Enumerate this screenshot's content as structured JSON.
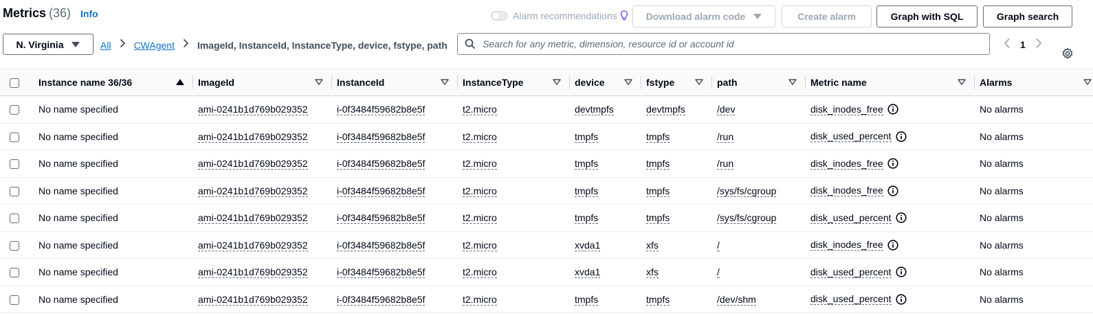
{
  "header": {
    "title": "Metrics",
    "count": "(36)",
    "info_label": "Info",
    "alarm_recommendations_label": "Alarm recommendations",
    "download_alarm_code_label": "Download alarm code",
    "create_alarm_label": "Create alarm",
    "graph_with_sql_label": "Graph with SQL",
    "graph_search_label": "Graph search"
  },
  "toolbar": {
    "region_label": "N. Virginia",
    "breadcrumb": {
      "all": "All",
      "namespace": "CWAgent",
      "current": "ImageId, InstanceId, InstanceType, device, fstype, path"
    },
    "search": {
      "placeholder": "Search for any metric, dimension, resource id or account id",
      "value": ""
    },
    "page_number": "1"
  },
  "table": {
    "columns": [
      "Instance name 36/36",
      "ImageId",
      "InstanceId",
      "InstanceType",
      "device",
      "fstype",
      "path",
      "Metric name",
      "Alarms"
    ],
    "rows": [
      {
        "instance_name": "No name specified",
        "image_id": "ami-0241b1d769b029352",
        "instance_id": "i-0f3484f59682b8e5f",
        "instance_type": "t2.micro",
        "device": "devtmpfs",
        "fstype": "devtmpfs",
        "path": "/dev",
        "metric": "disk_inodes_free",
        "alarms": "No alarms"
      },
      {
        "instance_name": "No name specified",
        "image_id": "ami-0241b1d769b029352",
        "instance_id": "i-0f3484f59682b8e5f",
        "instance_type": "t2.micro",
        "device": "tmpfs",
        "fstype": "tmpfs",
        "path": "/run",
        "metric": "disk_used_percent",
        "alarms": "No alarms"
      },
      {
        "instance_name": "No name specified",
        "image_id": "ami-0241b1d769b029352",
        "instance_id": "i-0f3484f59682b8e5f",
        "instance_type": "t2.micro",
        "device": "tmpfs",
        "fstype": "tmpfs",
        "path": "/run",
        "metric": "disk_inodes_free",
        "alarms": "No alarms"
      },
      {
        "instance_name": "No name specified",
        "image_id": "ami-0241b1d769b029352",
        "instance_id": "i-0f3484f59682b8e5f",
        "instance_type": "t2.micro",
        "device": "tmpfs",
        "fstype": "tmpfs",
        "path": "/sys/fs/cgroup",
        "metric": "disk_inodes_free",
        "alarms": "No alarms"
      },
      {
        "instance_name": "No name specified",
        "image_id": "ami-0241b1d769b029352",
        "instance_id": "i-0f3484f59682b8e5f",
        "instance_type": "t2.micro",
        "device": "tmpfs",
        "fstype": "tmpfs",
        "path": "/sys/fs/cgroup",
        "metric": "disk_used_percent",
        "alarms": "No alarms"
      },
      {
        "instance_name": "No name specified",
        "image_id": "ami-0241b1d769b029352",
        "instance_id": "i-0f3484f59682b8e5f",
        "instance_type": "t2.micro",
        "device": "xvda1",
        "fstype": "xfs",
        "path": "/",
        "metric": "disk_inodes_free",
        "alarms": "No alarms"
      },
      {
        "instance_name": "No name specified",
        "image_id": "ami-0241b1d769b029352",
        "instance_id": "i-0f3484f59682b8e5f",
        "instance_type": "t2.micro",
        "device": "xvda1",
        "fstype": "xfs",
        "path": "/",
        "metric": "disk_used_percent",
        "alarms": "No alarms"
      },
      {
        "instance_name": "No name specified",
        "image_id": "ami-0241b1d769b029352",
        "instance_id": "i-0f3484f59682b8e5f",
        "instance_type": "t2.micro",
        "device": "tmpfs",
        "fstype": "tmpfs",
        "path": "/dev/shm",
        "metric": "disk_used_percent",
        "alarms": "No alarms"
      }
    ]
  },
  "icons": {
    "search": "search-icon",
    "settings": "gear-icon",
    "info": "info-icon",
    "bulb": "lightbulb-icon"
  },
  "colors": {
    "link": "#0972d3",
    "text": "#000716",
    "muted": "#5f6b7a",
    "bulb_accent": "#8b5cf6"
  }
}
